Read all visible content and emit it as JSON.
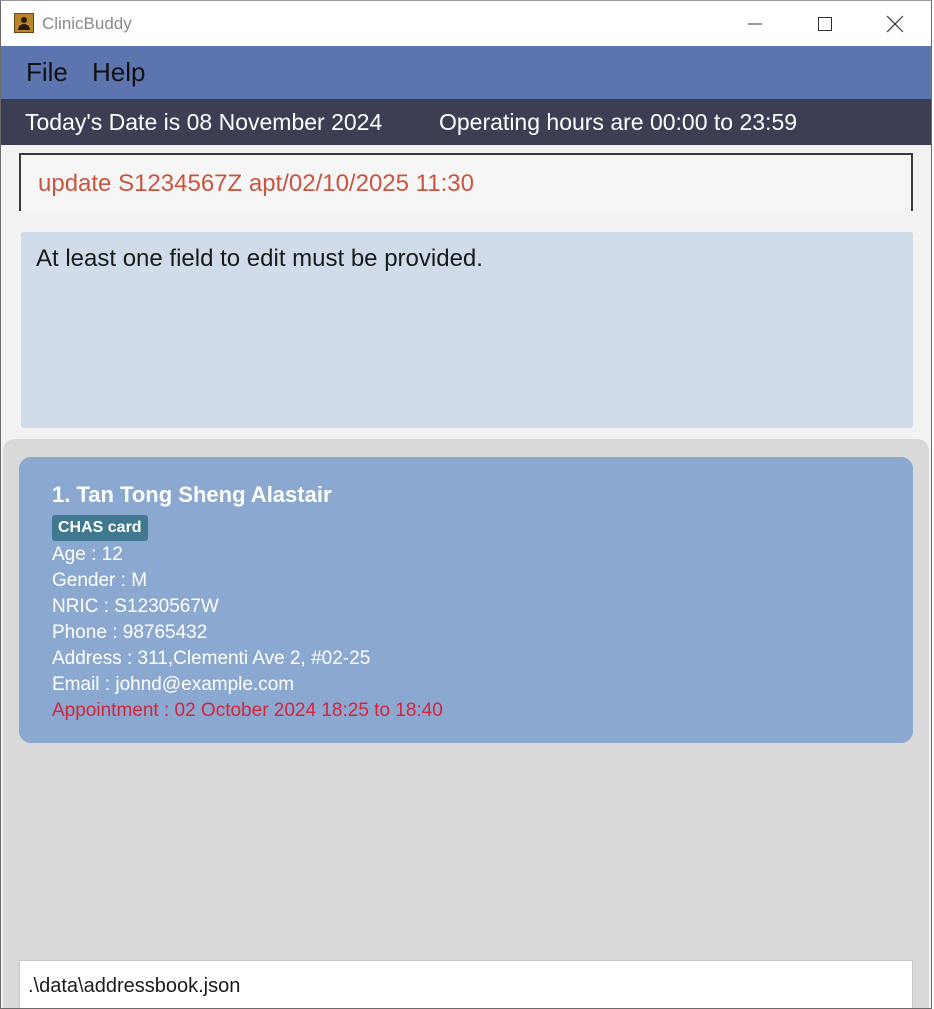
{
  "window": {
    "title": "ClinicBuddy",
    "icon": "person-icon",
    "controls": [
      "minimize-icon",
      "maximize-icon",
      "close-icon"
    ]
  },
  "menu": {
    "file_label": "File",
    "help_label": "Help"
  },
  "status": {
    "date_text": "Today's Date is 08 November 2024",
    "hours_text": "Operating hours are 00:00 to 23:59"
  },
  "command": {
    "value": "update S1234567Z apt/02/10/2025 11:30"
  },
  "result": {
    "message": "At least one field to edit must be provided."
  },
  "persons": [
    {
      "name": "1. Tan Tong Sheng Alastair",
      "tag": "CHAS card",
      "age": "Age : 12",
      "gender": "Gender : M",
      "nric": "NRIC : S1230567W",
      "phone": "Phone : 98765432",
      "address": "Address : 311,Clementi Ave 2, #02-25",
      "email": "Email : johnd@example.com",
      "appointment": "Appointment : 02 October 2024 18:25 to 18:40"
    }
  ],
  "footer": {
    "file_path": ".\\data\\addressbook.json"
  },
  "colors": {
    "menubar": "#5c75af",
    "statusbar": "#3c3f54",
    "command_text": "#c8553f",
    "result_bg": "#d0dcea",
    "card_bg": "#8ba8d0",
    "tag_bg": "#3f788f",
    "appointment_text": "#d4243c"
  }
}
